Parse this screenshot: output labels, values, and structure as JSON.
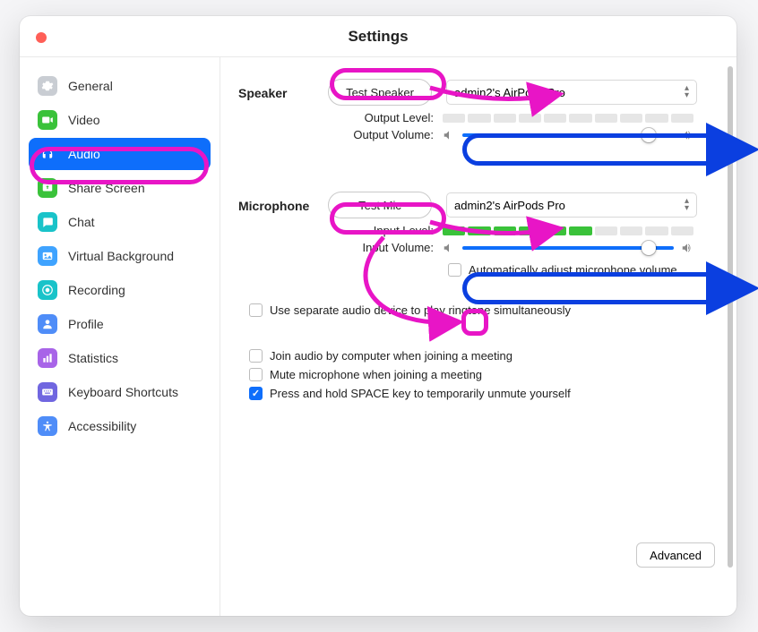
{
  "window": {
    "title": "Settings"
  },
  "sidebar": {
    "items": [
      {
        "label": "General",
        "icon": "gear",
        "color": "#c9cdd3",
        "active": false
      },
      {
        "label": "Video",
        "icon": "video",
        "color": "#3ac23a",
        "active": false
      },
      {
        "label": "Audio",
        "icon": "headphones",
        "color": "#ffffff",
        "active": true
      },
      {
        "label": "Share Screen",
        "icon": "share",
        "color": "#3ac23a",
        "active": false
      },
      {
        "label": "Chat",
        "icon": "chat",
        "color": "#19c3c9",
        "active": false
      },
      {
        "label": "Virtual Background",
        "icon": "image",
        "color": "#3fa3ff",
        "active": false
      },
      {
        "label": "Recording",
        "icon": "record",
        "color": "#19c3c9",
        "active": false
      },
      {
        "label": "Profile",
        "icon": "user",
        "color": "#4f8df8",
        "active": false
      },
      {
        "label": "Statistics",
        "icon": "stats",
        "color": "#a864e8",
        "active": false
      },
      {
        "label": "Keyboard Shortcuts",
        "icon": "keyboard",
        "color": "#7066e0",
        "active": false
      },
      {
        "label": "Accessibility",
        "icon": "accessibility",
        "color": "#4f8df8",
        "active": false
      }
    ]
  },
  "speaker": {
    "section_label": "Speaker",
    "test_label": "Test Speaker",
    "device": "admin2's AirPods Pro",
    "output_level_label": "Output Level:",
    "output_level_segments": 10,
    "output_level_active": 0,
    "output_volume_label": "Output Volume:",
    "output_volume_percent": 88
  },
  "microphone": {
    "section_label": "Microphone",
    "test_label": "Test Mic",
    "device": "admin2's AirPods Pro",
    "input_level_label": "Input Level:",
    "input_level_segments": 10,
    "input_level_active": 6,
    "input_volume_label": "Input Volume:",
    "input_volume_percent": 88,
    "auto_adjust_label": "Automatically adjust microphone volume",
    "auto_adjust_checked": false
  },
  "options": {
    "separate_device_label": "Use separate audio device to play ringtone simultaneously",
    "separate_device_checked": false,
    "join_audio_label": "Join audio by computer when joining a meeting",
    "join_audio_checked": false,
    "mute_on_join_label": "Mute microphone when joining a meeting",
    "mute_on_join_checked": false,
    "space_unmute_label": "Press and hold SPACE key to temporarily unmute yourself",
    "space_unmute_checked": true
  },
  "advanced_label": "Advanced",
  "annotations": {
    "highlights": [
      "sidebar-audio-item",
      "test-speaker-button",
      "test-mic-button",
      "output-volume-slider",
      "input-volume-slider",
      "auto-adjust-checkbox"
    ],
    "arrows": [
      "test-speaker-to-speaker-dropdown",
      "test-mic-to-mic-dropdown",
      "test-mic-to-auto-adjust-checkbox",
      "output-volume-to-right",
      "input-volume-to-right"
    ]
  }
}
